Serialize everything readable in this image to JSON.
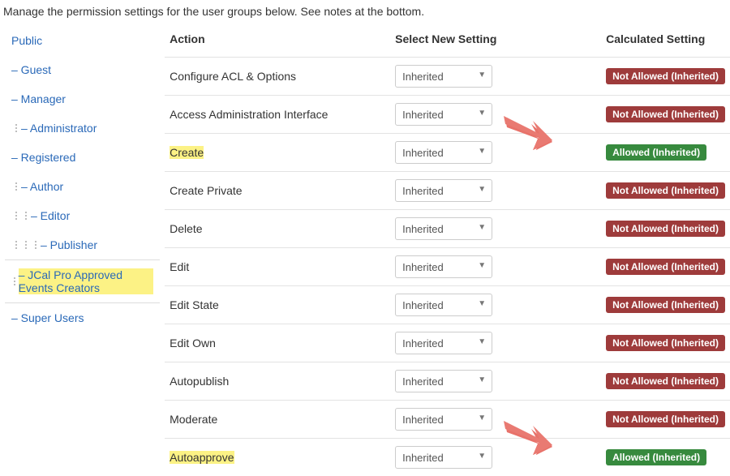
{
  "intro": "Manage the permission settings for the user groups below. See notes at the bottom.",
  "tree": {
    "items": [
      {
        "label": "Public",
        "depth": 0,
        "prefix": "",
        "highlight": false,
        "active": false
      },
      {
        "label": "Guest",
        "depth": 0,
        "prefix": "– ",
        "highlight": false,
        "active": false
      },
      {
        "label": "Manager",
        "depth": 0,
        "prefix": "– ",
        "highlight": false,
        "active": false
      },
      {
        "label": "Administrator",
        "depth": 1,
        "prefix": "– ",
        "highlight": false,
        "active": false
      },
      {
        "label": "Registered",
        "depth": 0,
        "prefix": "– ",
        "highlight": false,
        "active": false
      },
      {
        "label": "Author",
        "depth": 1,
        "prefix": "– ",
        "highlight": false,
        "active": false
      },
      {
        "label": "Editor",
        "depth": 2,
        "prefix": "– ",
        "highlight": false,
        "active": false
      },
      {
        "label": "Publisher",
        "depth": 3,
        "prefix": "– ",
        "highlight": false,
        "active": false
      },
      {
        "label": "JCal Pro Approved Events Creators",
        "depth": 1,
        "prefix": "– ",
        "highlight": true,
        "active": true
      },
      {
        "label": "Super Users",
        "depth": 0,
        "prefix": "– ",
        "highlight": false,
        "active": false
      }
    ]
  },
  "headers": {
    "action": "Action",
    "setting": "Select New Setting",
    "calc": "Calculated Setting"
  },
  "select_value": "Inherited",
  "badges": {
    "deny": "Not Allowed (Inherited)",
    "allow": "Allowed (Inherited)"
  },
  "rows": [
    {
      "action": "Configure ACL & Options",
      "highlight": false,
      "status": "deny",
      "arrow": false
    },
    {
      "action": "Access Administration Interface",
      "highlight": false,
      "status": "deny",
      "arrow": false
    },
    {
      "action": "Create",
      "highlight": true,
      "status": "allow",
      "arrow": true
    },
    {
      "action": "Create Private",
      "highlight": false,
      "status": "deny",
      "arrow": false
    },
    {
      "action": "Delete",
      "highlight": false,
      "status": "deny",
      "arrow": false
    },
    {
      "action": "Edit",
      "highlight": false,
      "status": "deny",
      "arrow": false
    },
    {
      "action": "Edit State",
      "highlight": false,
      "status": "deny",
      "arrow": false
    },
    {
      "action": "Edit Own",
      "highlight": false,
      "status": "deny",
      "arrow": false
    },
    {
      "action": "Autopublish",
      "highlight": false,
      "status": "deny",
      "arrow": false
    },
    {
      "action": "Moderate",
      "highlight": false,
      "status": "deny",
      "arrow": false
    },
    {
      "action": "Autoapprove",
      "highlight": true,
      "status": "allow",
      "arrow": true
    }
  ]
}
